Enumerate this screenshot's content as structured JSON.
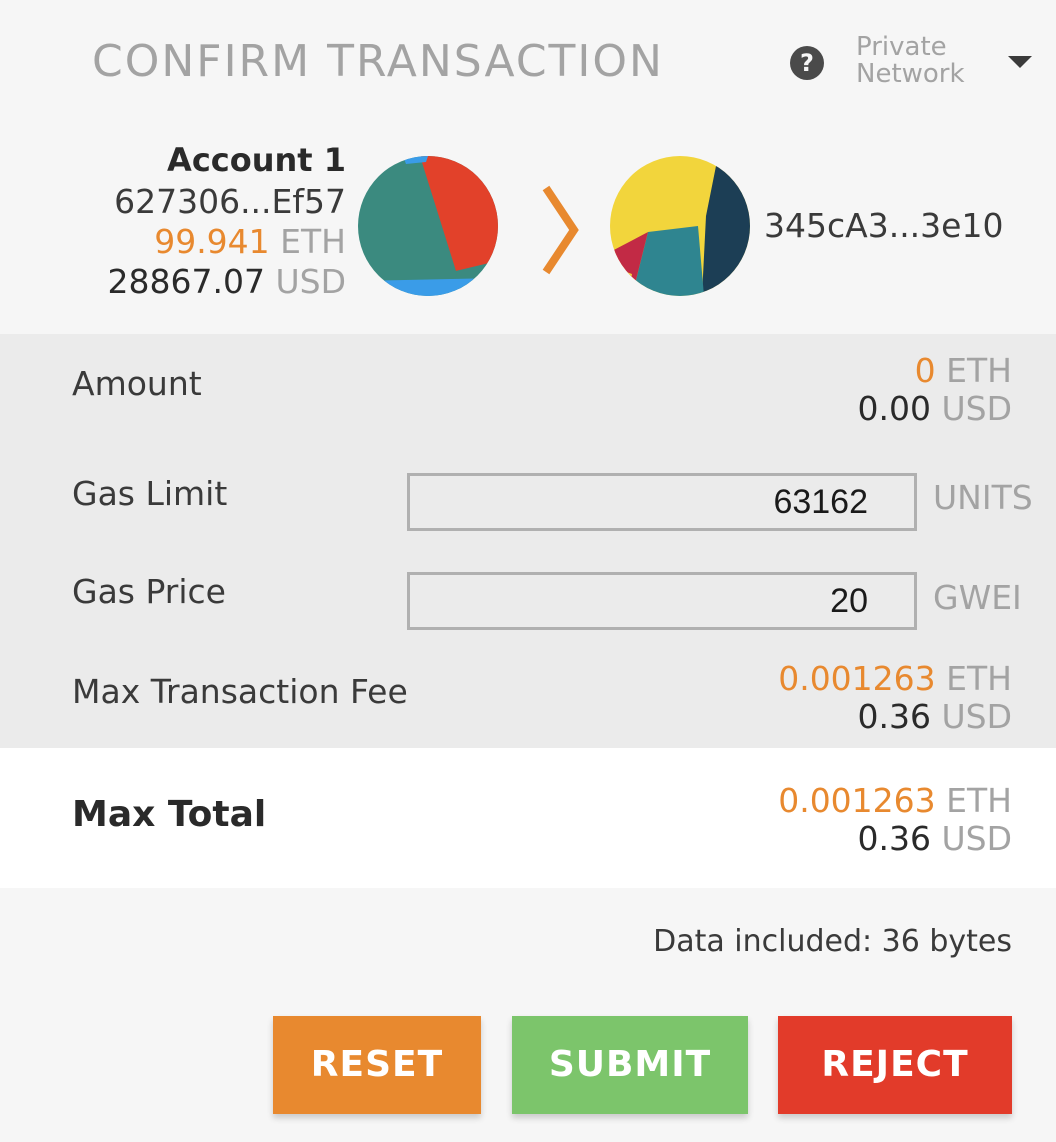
{
  "header": {
    "title": "CONFIRM TRANSACTION",
    "help_icon": "help-icon",
    "network_line1": "Private",
    "network_line2": "Network"
  },
  "from": {
    "name": "Account 1",
    "address": "627306...Ef57",
    "balance_eth": "99.941",
    "balance_eth_unit": "ETH",
    "balance_usd": "28867.07",
    "balance_usd_unit": "USD"
  },
  "to": {
    "address": "345cA3...3e10"
  },
  "amount": {
    "label": "Amount",
    "eth": "0",
    "eth_unit": "ETH",
    "usd": "0.00",
    "usd_unit": "USD"
  },
  "gas_limit": {
    "label": "Gas Limit",
    "value": "63162",
    "unit": "UNITS"
  },
  "gas_price": {
    "label": "Gas Price",
    "value": "20",
    "unit": "GWEI"
  },
  "max_fee": {
    "label": "Max Transaction Fee",
    "eth": "0.001263",
    "eth_unit": "ETH",
    "usd": "0.36",
    "usd_unit": "USD"
  },
  "max_total": {
    "label": "Max Total",
    "eth": "0.001263",
    "eth_unit": "ETH",
    "usd": "0.36",
    "usd_unit": "USD"
  },
  "data_note": "Data included: 36 bytes",
  "buttons": {
    "reset": "RESET",
    "submit": "SUBMIT",
    "reject": "REJECT"
  },
  "colors": {
    "accent_orange": "#e8892f",
    "submit_green": "#7cc56b",
    "reject_red": "#e23b2a",
    "muted_gray": "#a3a3a3"
  }
}
